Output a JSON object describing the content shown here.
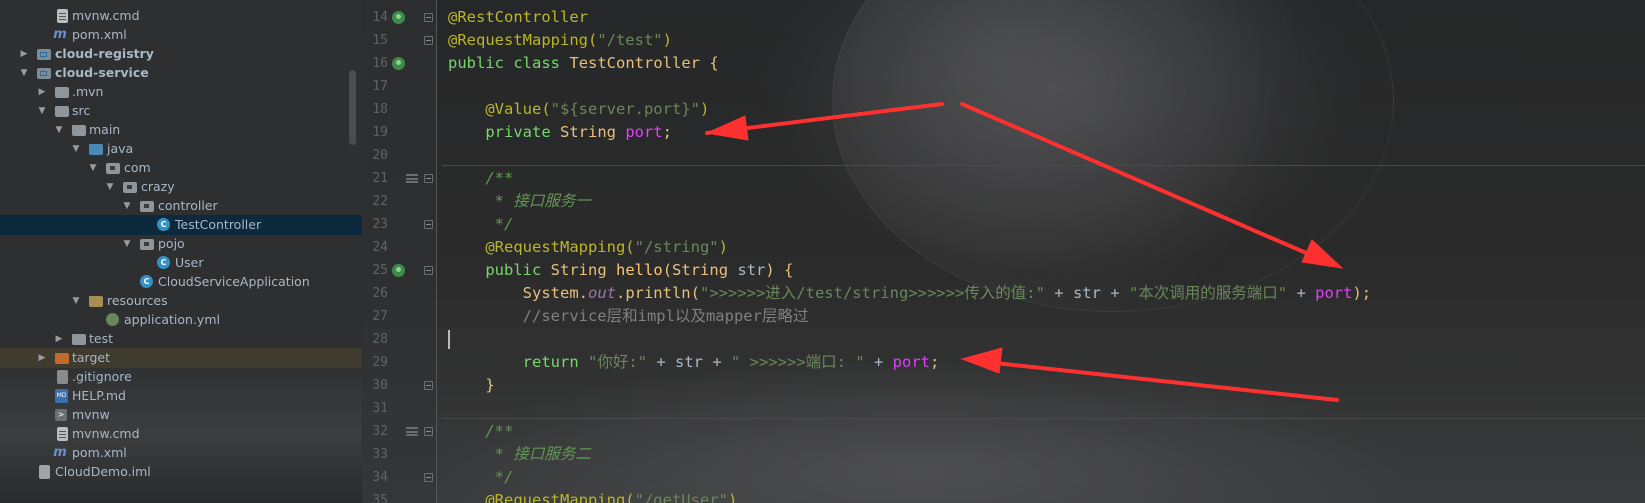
{
  "project_tree": {
    "items": [
      {
        "label": "mvnw.cmd",
        "icon": "file-icon"
      },
      {
        "label": "pom.xml",
        "icon": "maven-icon"
      },
      {
        "label": "cloud-registry",
        "icon": "module-icon"
      },
      {
        "label": "cloud-service",
        "icon": "module-icon"
      },
      {
        "label": ".mvn",
        "icon": "folder-icon"
      },
      {
        "label": "src",
        "icon": "folder-icon"
      },
      {
        "label": "main",
        "icon": "folder-icon"
      },
      {
        "label": "java",
        "icon": "source-folder-icon"
      },
      {
        "label": "com",
        "icon": "package-icon"
      },
      {
        "label": "crazy",
        "icon": "package-icon"
      },
      {
        "label": "controller",
        "icon": "package-icon"
      },
      {
        "label": "TestController",
        "icon": "class-icon"
      },
      {
        "label": "pojo",
        "icon": "package-icon"
      },
      {
        "label": "User",
        "icon": "class-icon"
      },
      {
        "label": "CloudServiceApplication",
        "icon": "spring-boot-class-icon"
      },
      {
        "label": "resources",
        "icon": "resources-folder-icon"
      },
      {
        "label": "application.yml",
        "icon": "yaml-icon"
      },
      {
        "label": "test",
        "icon": "folder-icon"
      },
      {
        "label": "target",
        "icon": "excluded-folder-icon"
      },
      {
        "label": ".gitignore",
        "icon": "gitignore-icon"
      },
      {
        "label": "HELP.md",
        "icon": "markdown-icon"
      },
      {
        "label": "mvnw",
        "icon": "shell-icon"
      },
      {
        "label": "mvnw.cmd",
        "icon": "file-icon"
      },
      {
        "label": "pom.xml",
        "icon": "maven-icon"
      },
      {
        "label": "CloudDemo.iml",
        "icon": "iml-icon"
      }
    ],
    "selected": "TestController",
    "class_glyph": "C",
    "md_glyph": "MD",
    "shell_glyph": ">",
    "maven_glyph": "m"
  },
  "editor": {
    "line_numbers": [
      "14",
      "15",
      "16",
      "17",
      "18",
      "19",
      "20",
      "21",
      "22",
      "23",
      "24",
      "25",
      "26",
      "27",
      "28",
      "29",
      "30",
      "31",
      "32",
      "33",
      "34",
      "35"
    ],
    "code": {
      "l14": {
        "a": "@RestController"
      },
      "l15": {
        "a": "@RequestMapping(",
        "s": "\"/test\"",
        "b": ")"
      },
      "l16": {
        "k1": "public",
        "k2": "class",
        "t": "TestController",
        "p": " {"
      },
      "l18": {
        "a": "@Value(",
        "s": "\"${server.port}\"",
        "b": ")"
      },
      "l19": {
        "k": "private",
        "t": "String",
        "f": "port",
        "p": ";"
      },
      "l21": {
        "c": "/**"
      },
      "l22": {
        "c": " * 接口服务一"
      },
      "l23": {
        "c": " */"
      },
      "l24": {
        "a": "@RequestMapping(",
        "s": "\"/string\"",
        "b": ")"
      },
      "l25": {
        "k": "public",
        "t": "String",
        "fn": "hello",
        "p1": "(",
        "t2": "String",
        "v": "str",
        "p2": ") {"
      },
      "l26": {
        "sys": "System.",
        "out": "out",
        "pr": ".println(",
        "s1": "\">>>>>>进入/test/string>>>>>>传入的值:\"",
        "o1": " + str + ",
        "s2": "\"本次调用的服务端口\"",
        "o2": " + ",
        "f": "port",
        "e": ");"
      },
      "l27": {
        "c": "//service层和impl以及mapper层略过"
      },
      "l29": {
        "k": "return",
        "s1": "\"你好:\"",
        "o1": " + str + ",
        "s2": "\" >>>>>>端口: \"",
        "o2": " + ",
        "f": "port",
        "e": ";"
      },
      "l30": {
        "p": "}"
      },
      "l32": {
        "c": "/**"
      },
      "l33": {
        "c": " * 接口服务二"
      },
      "l34": {
        "c": " */"
      },
      "l35": {
        "a": "@RequestMapping(",
        "s": "\"/getUser\"",
        "b": ")"
      }
    }
  },
  "colors": {
    "annotation": "#bbb529",
    "keyword": "#78d66b",
    "string": "#6a8759",
    "field": "#e040fb",
    "arrow": "#ff3030"
  }
}
